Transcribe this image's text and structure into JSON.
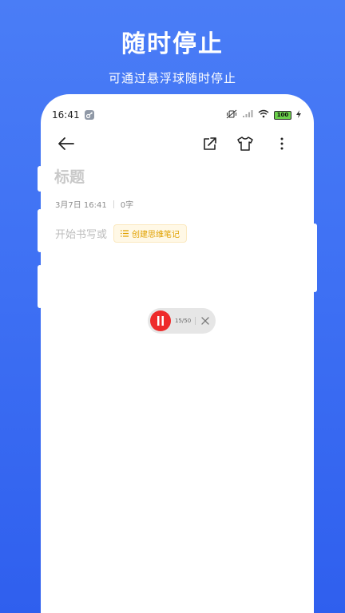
{
  "promo": {
    "title": "随时停止",
    "subtitle": "可通过悬浮球随时停止"
  },
  "status_bar": {
    "time": "16:41",
    "battery": "100",
    "icons": [
      "key-icon",
      "mute-vibrate-icon",
      "signal-icon",
      "wifi-icon",
      "battery-icon",
      "charging-icon"
    ]
  },
  "toolbar": {
    "icons": [
      "back-arrow-icon",
      "share-icon",
      "theme-shirt-icon",
      "more-vertical-icon"
    ]
  },
  "note": {
    "title_placeholder": "标题",
    "date": "3月7日 16:41",
    "word_count": "0字",
    "body_placeholder": "开始书写或",
    "mindmap_label": "创建思维笔记"
  },
  "recorder": {
    "progress": "15/50"
  },
  "colors": {
    "background_top": "#4a7df6",
    "background_bottom": "#2f5fee",
    "record_red": "#ee2b2b",
    "chip_text": "#e0a100",
    "chip_bg": "#fff8e6"
  }
}
